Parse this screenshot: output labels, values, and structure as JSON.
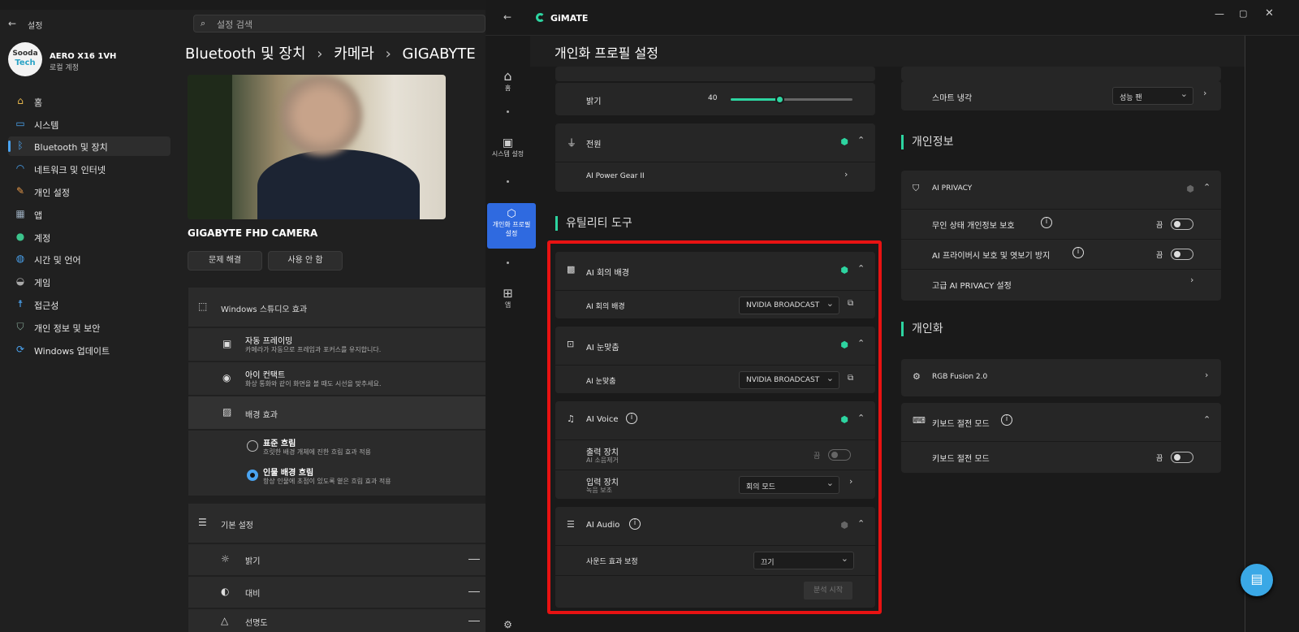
{
  "settings": {
    "title": "설정",
    "search_placeholder": "설정 검색",
    "user": {
      "avatar_l1": "Sooda",
      "avatar_l2": "Tech",
      "name": "AERO X16 1VH",
      "type": "로컬 계정"
    },
    "nav": [
      {
        "label": "홈",
        "icon": "home-icon"
      },
      {
        "label": "시스템",
        "icon": "monitor-icon"
      },
      {
        "label": "Bluetooth 및 장치",
        "icon": "bluetooth-icon"
      },
      {
        "label": "네트워크 및 인터넷",
        "icon": "wifi-icon"
      },
      {
        "label": "개인 설정",
        "icon": "brush-icon"
      },
      {
        "label": "앱",
        "icon": "apps-icon"
      },
      {
        "label": "계정",
        "icon": "account-icon"
      },
      {
        "label": "시간 및 언어",
        "icon": "globe-icon"
      },
      {
        "label": "게임",
        "icon": "gamepad-icon"
      },
      {
        "label": "접근성",
        "icon": "accessibility-icon"
      },
      {
        "label": "개인 정보 및 보안",
        "icon": "shield-icon"
      },
      {
        "label": "Windows 업데이트",
        "icon": "update-icon"
      }
    ],
    "breadcrumb": {
      "part1": "Bluetooth 및 장치",
      "sep": "›",
      "part2": "카메라",
      "part3": "GIGABYTE"
    },
    "camera_name": "GIGABYTE FHD CAMERA",
    "btn_troubleshoot": "문제 해결",
    "btn_disable": "사용 안 함",
    "studio_effects": "Windows 스튜디오 효과",
    "auto_framing": {
      "title": "자동 프레이밍",
      "desc": "카메라가 자동으로 프레임과 포커스를 유지합니다."
    },
    "eye_contact": {
      "title": "아이 컨택트",
      "desc": "화상 통화와 같이 화면을 볼 때도 시선을 맞추세요."
    },
    "bg_effects": "배경 효과",
    "std_blur": {
      "title": "표준 흐림",
      "desc": "흐릿한 배경 개체에 진한 흐림 효과 적용"
    },
    "portrait_blur": {
      "title": "인물 배경 흐림",
      "desc": "항상 인물에 초점이 있도록 옅은 흐림 효과 적용"
    },
    "basic_settings": "기본 설정",
    "brightness": "밝기",
    "contrast": "대비",
    "sharpness": "선명도"
  },
  "gimate": {
    "app_name": "GiMATE",
    "page_title": "개인화 프로필 설정",
    "side": [
      {
        "label": "홈",
        "icon": "home-icon"
      },
      {
        "label": "시스템 설정",
        "icon": "chip-icon"
      },
      {
        "label": "개인화 프로필 설정",
        "icon": "cube-icon"
      },
      {
        "label": "앱",
        "icon": "apps-grid-icon"
      }
    ],
    "brightness_label": "밝기",
    "brightness_value": "40",
    "brightness_level": 0.4,
    "power": "전원",
    "ai_power_gear": "AI Power Gear II",
    "utility_title": "유틸리티 도구",
    "ai_meeting_bg": "AI 회의 배경",
    "ai_meeting_bg_sub": "AI 회의 배경",
    "ai_meeting_bg_value": "NVIDIA BROADCAST",
    "ai_eye": "AI 눈맞춤",
    "ai_eye_sub": "AI 눈맞춤",
    "ai_eye_value": "NVIDIA BROADCAST",
    "ai_voice": "AI Voice",
    "output_device": "출력 장치",
    "output_sub": "AI 소음제거",
    "output_state": "끔",
    "input_device": "입력 장치",
    "input_sub": "녹음 보조",
    "input_value": "회의 모드",
    "ai_audio": "AI Audio",
    "sound_fx": "사운드 효과 보정",
    "sound_fx_value": "끄기",
    "analyze_btn": "분석 시작",
    "smart_cooling": "스마트 냉각",
    "smart_cooling_value": "성능 팬",
    "privacy_title": "개인정보",
    "ai_privacy": "AI PRIVACY",
    "unattended": "무인 상태 개인정보 보호",
    "unattended_state": "끔",
    "ai_peek": "AI 프라이버시 보호 및 엿보기 방지",
    "ai_peek_state": "끔",
    "adv_privacy": "고급 AI PRIVACY 설정",
    "personalize_title": "개인화",
    "rgb": "RGB Fusion 2.0",
    "kb_power": "키보드 절전 모드",
    "kb_power_sub": "키보드 절전 모드",
    "kb_power_state": "끔"
  },
  "colors": {
    "accent": "#2dd4a0",
    "windows_blue": "#3a8bf0",
    "highlight": "#e81212",
    "gimate_side_active": "#2f6ae0"
  }
}
